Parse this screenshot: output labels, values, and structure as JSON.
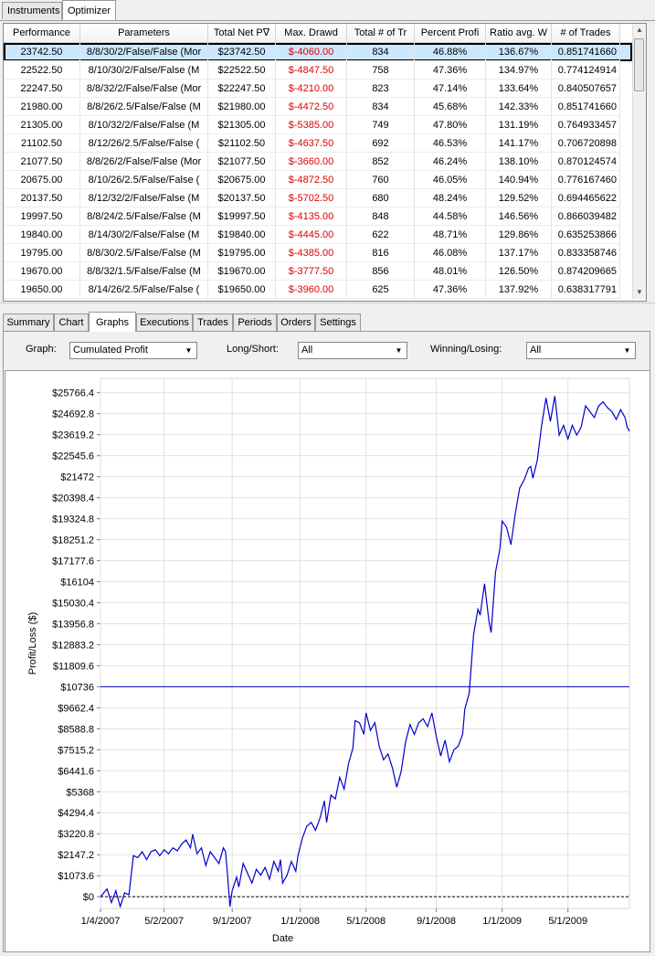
{
  "top_tabs": [
    "Instruments",
    "Optimizer"
  ],
  "grid": {
    "columns": [
      "Performance",
      "Parameters",
      "Total Net P∇",
      "Max. Drawd",
      "Total # of Tr",
      "Percent Profi",
      "Ratio avg. W",
      "# of Trades"
    ],
    "rows": [
      [
        "23742.50",
        "8/8/30/2/False/False (Mor",
        "$23742.50",
        "$-4060.00",
        "834",
        "46.88%",
        "136.67%",
        "0.851741660"
      ],
      [
        "22522.50",
        "8/10/30/2/False/False (M",
        "$22522.50",
        "$-4847.50",
        "758",
        "47.36%",
        "134.97%",
        "0.774124914"
      ],
      [
        "22247.50",
        "8/8/32/2/False/False (Mor",
        "$22247.50",
        "$-4210.00",
        "823",
        "47.14%",
        "133.64%",
        "0.840507657"
      ],
      [
        "21980.00",
        "8/8/26/2.5/False/False (M",
        "$21980.00",
        "$-4472.50",
        "834",
        "45.68%",
        "142.33%",
        "0.851741660"
      ],
      [
        "21305.00",
        "8/10/32/2/False/False (M",
        "$21305.00",
        "$-5385.00",
        "749",
        "47.80%",
        "131.19%",
        "0.764933457"
      ],
      [
        "21102.50",
        "8/12/26/2.5/False/False (",
        "$21102.50",
        "$-4637.50",
        "692",
        "46.53%",
        "141.17%",
        "0.706720898"
      ],
      [
        "21077.50",
        "8/8/26/2/False/False (Mor",
        "$21077.50",
        "$-3660.00",
        "852",
        "46.24%",
        "138.10%",
        "0.870124574"
      ],
      [
        "20675.00",
        "8/10/26/2.5/False/False (",
        "$20675.00",
        "$-4872.50",
        "760",
        "46.05%",
        "140.94%",
        "0.776167460"
      ],
      [
        "20137.50",
        "8/12/32/2/False/False (M",
        "$20137.50",
        "$-5702.50",
        "680",
        "48.24%",
        "129.52%",
        "0.694465622"
      ],
      [
        "19997.50",
        "8/8/24/2.5/False/False (M",
        "$19997.50",
        "$-4135.00",
        "848",
        "44.58%",
        "146.56%",
        "0.866039482"
      ],
      [
        "19840.00",
        "8/14/30/2/False/False (M",
        "$19840.00",
        "$-4445.00",
        "622",
        "48.71%",
        "129.86%",
        "0.635253866"
      ],
      [
        "19795.00",
        "8/8/30/2.5/False/False (M",
        "$19795.00",
        "$-4385.00",
        "816",
        "46.08%",
        "137.17%",
        "0.833358746"
      ],
      [
        "19670.00",
        "8/8/32/1.5/False/False (M",
        "$19670.00",
        "$-3777.50",
        "856",
        "48.01%",
        "126.50%",
        "0.874209665"
      ],
      [
        "19650.00",
        "8/14/26/2.5/False/False (",
        "$19650.00",
        "$-3960.00",
        "625",
        "47.36%",
        "137.92%",
        "0.638317791"
      ]
    ]
  },
  "lower_tabs": [
    "Summary",
    "Chart",
    "Graphs",
    "Executions",
    "Trades",
    "Periods",
    "Orders",
    "Settings"
  ],
  "controls": {
    "graph_label": "Graph:",
    "graph_value": "Cumulated Profit",
    "longshort_label": "Long/Short:",
    "longshort_value": "All",
    "winlose_label": "Winning/Losing:",
    "winlose_value": "All"
  },
  "colors": {
    "line": "#0000cc",
    "negative": "#e00000",
    "selected_row": "#cce8ff"
  },
  "chart_data": {
    "type": "line",
    "xlabel": "Date",
    "ylabel": "Profit/Loss ($)",
    "x_ticks": [
      "1/4/2007",
      "5/2/2007",
      "9/1/2007",
      "1/1/2008",
      "5/1/2008",
      "9/1/2008",
      "1/1/2009",
      "5/1/2009"
    ],
    "y_ticks": [
      "$0",
      "$1073.6",
      "$2147.2",
      "$3220.8",
      "$4294.4",
      "$5368",
      "$6441.6",
      "$7515.2",
      "$8588.8",
      "$9662.4",
      "$10736",
      "$11809.6",
      "$12883.2",
      "$13956.8",
      "$15030.4",
      "$16104",
      "$17177.6",
      "$18251.2",
      "$19324.8",
      "$20398.4",
      "$21472",
      "$22545.6",
      "$23619.2",
      "$24692.8",
      "$25766.4"
    ],
    "ylim": [
      -600,
      26500
    ],
    "reference_line": 10736,
    "zero_line": 0,
    "series": [
      {
        "points": [
          [
            0,
            0
          ],
          [
            3,
            400
          ],
          [
            5,
            -300
          ],
          [
            7,
            300
          ],
          [
            9,
            -500
          ],
          [
            11,
            200
          ],
          [
            13,
            100
          ],
          [
            15,
            2100
          ],
          [
            17,
            2000
          ],
          [
            19,
            2300
          ],
          [
            21,
            1900
          ],
          [
            23,
            2300
          ],
          [
            25,
            2400
          ],
          [
            27,
            2100
          ],
          [
            29,
            2400
          ],
          [
            31,
            2200
          ],
          [
            33,
            2500
          ],
          [
            35,
            2350
          ],
          [
            37,
            2700
          ],
          [
            39,
            2900
          ],
          [
            41,
            2500
          ],
          [
            42,
            3200
          ],
          [
            44,
            2200
          ],
          [
            46,
            2500
          ],
          [
            48,
            1600
          ],
          [
            50,
            2300
          ],
          [
            52,
            2000
          ],
          [
            54,
            1700
          ],
          [
            56,
            2500
          ],
          [
            57,
            2300
          ],
          [
            58,
            1000
          ],
          [
            59,
            -500
          ],
          [
            60,
            300
          ],
          [
            62,
            1000
          ],
          [
            63,
            500
          ],
          [
            65,
            1700
          ],
          [
            67,
            1200
          ],
          [
            69,
            700
          ],
          [
            71,
            1400
          ],
          [
            73,
            1100
          ],
          [
            75,
            1500
          ],
          [
            77,
            900
          ],
          [
            79,
            1800
          ],
          [
            81,
            1300
          ],
          [
            82,
            1900
          ],
          [
            83,
            700
          ],
          [
            85,
            1100
          ],
          [
            87,
            1800
          ],
          [
            89,
            1300
          ],
          [
            90,
            2100
          ],
          [
            92,
            3000
          ],
          [
            94,
            3600
          ],
          [
            96,
            3800
          ],
          [
            98,
            3400
          ],
          [
            100,
            4000
          ],
          [
            102,
            4900
          ],
          [
            103,
            3800
          ],
          [
            105,
            5200
          ],
          [
            107,
            5000
          ],
          [
            109,
            6100
          ],
          [
            111,
            5500
          ],
          [
            113,
            6800
          ],
          [
            115,
            7600
          ],
          [
            116,
            9000
          ],
          [
            118,
            8900
          ],
          [
            120,
            8300
          ],
          [
            121,
            9400
          ],
          [
            123,
            8500
          ],
          [
            125,
            8900
          ],
          [
            127,
            7700
          ],
          [
            129,
            7000
          ],
          [
            131,
            7300
          ],
          [
            133,
            6600
          ],
          [
            135,
            5600
          ],
          [
            137,
            6400
          ],
          [
            139,
            7900
          ],
          [
            141,
            8800
          ],
          [
            143,
            8300
          ],
          [
            145,
            8900
          ],
          [
            147,
            9100
          ],
          [
            149,
            8700
          ],
          [
            151,
            9400
          ],
          [
            153,
            8200
          ],
          [
            155,
            7200
          ],
          [
            157,
            8000
          ],
          [
            159,
            6900
          ],
          [
            161,
            7500
          ],
          [
            163,
            7700
          ],
          [
            165,
            8300
          ],
          [
            166,
            9600
          ],
          [
            168,
            10400
          ],
          [
            170,
            13400
          ],
          [
            172,
            14700
          ],
          [
            173,
            14400
          ],
          [
            175,
            16000
          ],
          [
            177,
            14100
          ],
          [
            178,
            13500
          ],
          [
            180,
            16600
          ],
          [
            182,
            17800
          ],
          [
            183,
            19200
          ],
          [
            185,
            18900
          ],
          [
            187,
            18000
          ],
          [
            189,
            19600
          ],
          [
            191,
            20900
          ],
          [
            193,
            21300
          ],
          [
            195,
            21900
          ],
          [
            196,
            22000
          ],
          [
            197,
            21400
          ],
          [
            199,
            22300
          ],
          [
            201,
            24100
          ],
          [
            203,
            25500
          ],
          [
            205,
            24300
          ],
          [
            207,
            25600
          ],
          [
            209,
            23600
          ],
          [
            211,
            24100
          ],
          [
            213,
            23400
          ],
          [
            215,
            24100
          ],
          [
            217,
            23600
          ],
          [
            219,
            24000
          ],
          [
            221,
            25100
          ],
          [
            223,
            24800
          ],
          [
            225,
            24500
          ],
          [
            227,
            25100
          ],
          [
            229,
            25300
          ],
          [
            231,
            25000
          ],
          [
            233,
            24800
          ],
          [
            235,
            24400
          ],
          [
            237,
            24900
          ],
          [
            239,
            24500
          ],
          [
            240,
            24000
          ],
          [
            241,
            23800
          ]
        ]
      }
    ]
  }
}
